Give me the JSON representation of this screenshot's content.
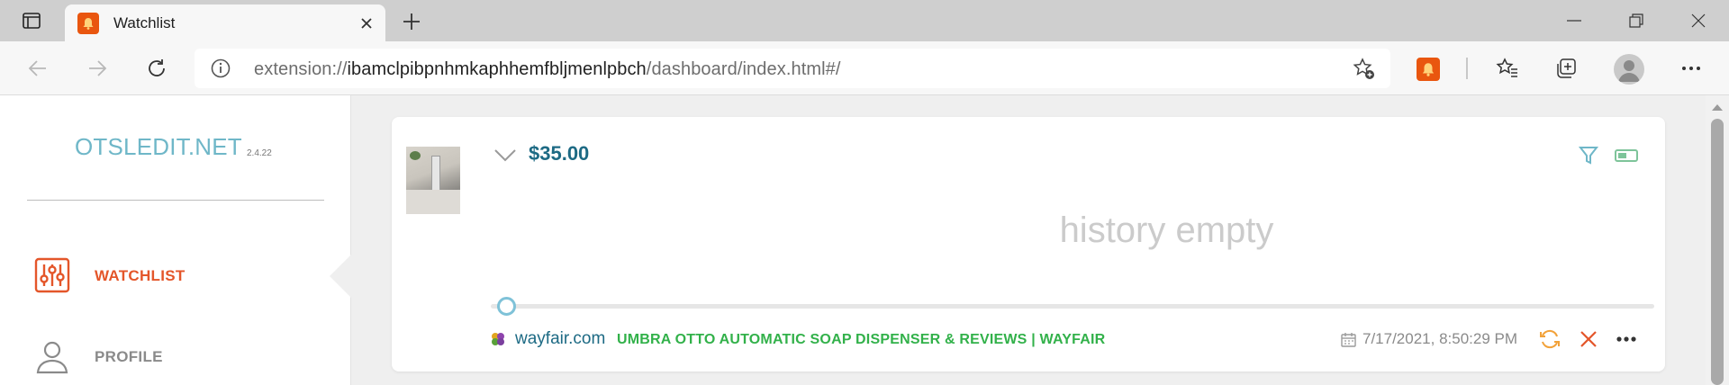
{
  "browser": {
    "tab_title": "Watchlist",
    "url_scheme": "extension://",
    "url_host": "ibamclpibpnhmkaphhemfbljmenlpbch",
    "url_path": "/dashboard/index.html#/"
  },
  "sidebar": {
    "brand": "OTSLEDIT.NET",
    "version": "2.4.22",
    "items": [
      {
        "label": "WATCHLIST",
        "icon": "sliders-icon",
        "active": true,
        "color": "#e4562a"
      },
      {
        "label": "PROFILE",
        "icon": "user-icon",
        "active": false,
        "color": "#8a8a8a"
      }
    ]
  },
  "item": {
    "price": "$35.00",
    "history_text": "history empty",
    "site": "wayfair.com",
    "title": "UMBRA OTTO AUTOMATIC SOAP DISPENSER & REVIEWS | WAYFAIR",
    "date": "7/17/2021, 8:50:29 PM"
  },
  "colors": {
    "accent": "#1d6a84",
    "brand": "#6fb7c8",
    "title_green": "#32b14a",
    "danger": "#e4562a",
    "refresh": "#f2a23a"
  }
}
